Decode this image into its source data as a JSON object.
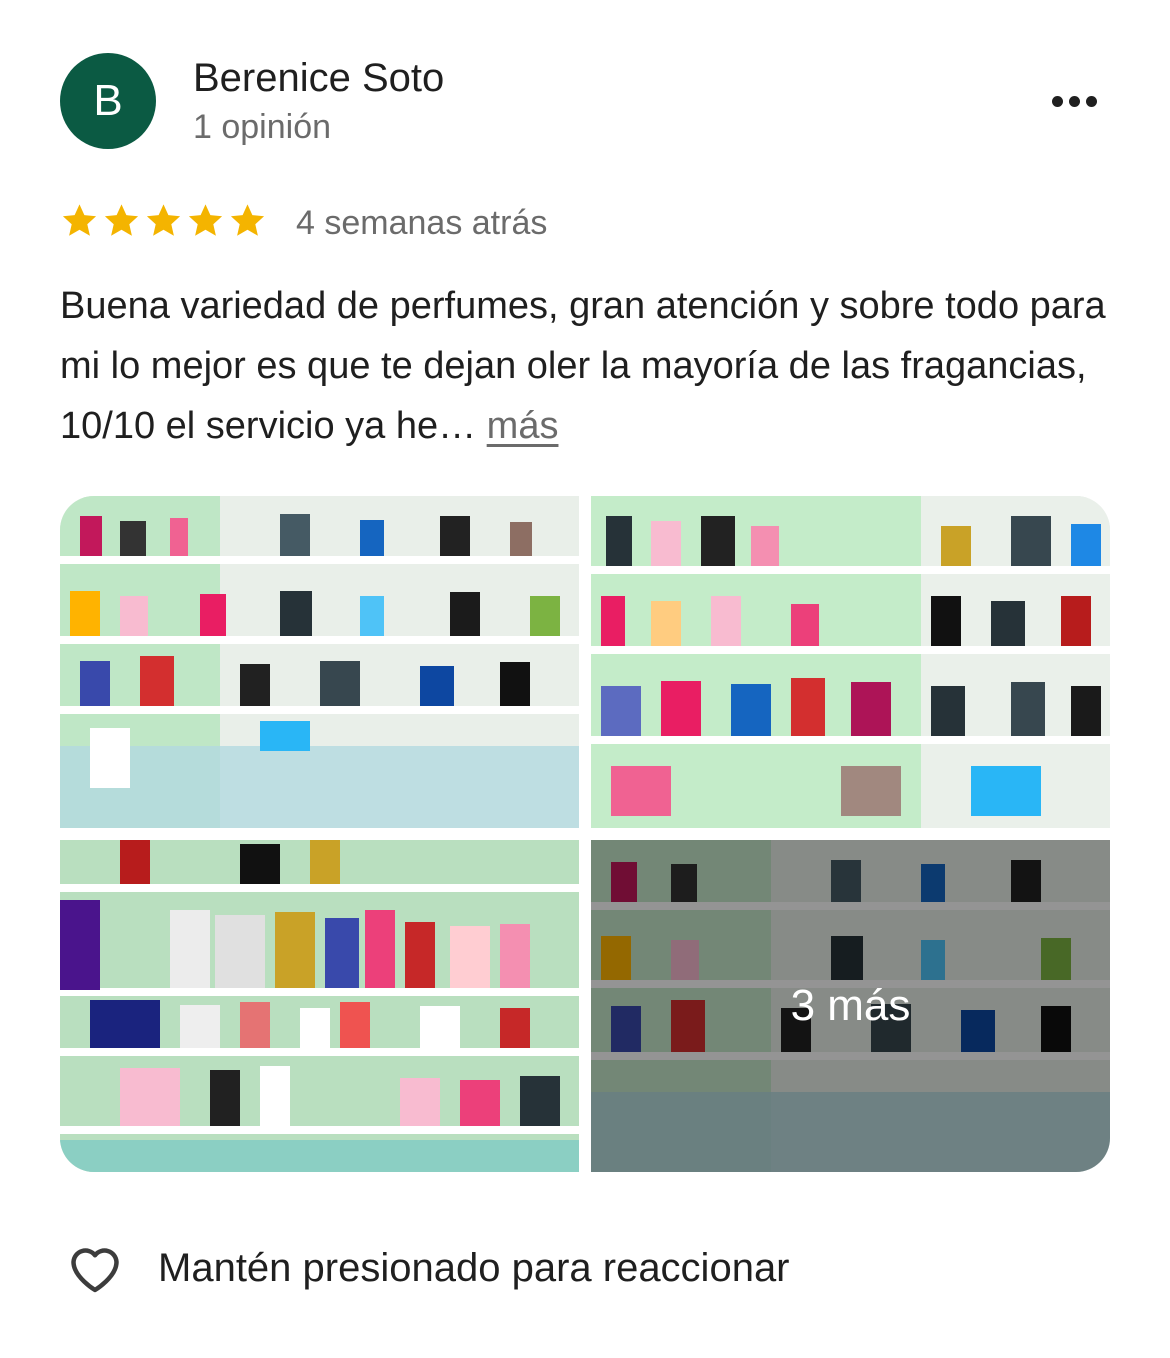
{
  "author": {
    "initial": "B",
    "avatar_color": "#0b5a43",
    "name": "Berenice Soto",
    "meta": "1 opinión"
  },
  "menu_icon": "more-horizontal-icon",
  "rating": {
    "stars": 5,
    "max": 5,
    "color": "#f4b400"
  },
  "time": "4 semanas atrás",
  "review": {
    "text": "Buena variedad de perfumes, gran atención y sobre todo para mi lo mejor es que te dejan oler la mayoría de las fragancias, 10/10 el servicio ya he…",
    "more_label": "más"
  },
  "photos": {
    "more_label": "3 más"
  },
  "reaction": {
    "icon": "heart-outline-icon",
    "label": "Mantén presionado para reaccionar"
  }
}
